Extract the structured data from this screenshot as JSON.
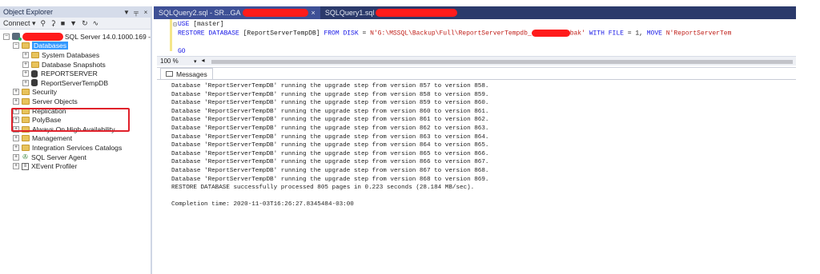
{
  "object_explorer": {
    "title": "Object Explorer",
    "title_buttons": [
      "▼",
      "╤",
      "×"
    ],
    "toolbar": {
      "connect_label": "Connect ▾",
      "icons": [
        "connect-icon",
        "disconnect-icon",
        "stop-icon",
        "filter-icon",
        "refresh-icon",
        "activity-icon"
      ]
    },
    "server_label": "SQL Server 14.0.1000.169 -",
    "tree": [
      {
        "label": "Databases",
        "level": 1,
        "icon": "folder",
        "expanded": true,
        "selected": true
      },
      {
        "label": "System Databases",
        "level": 2,
        "icon": "folder"
      },
      {
        "label": "Database Snapshots",
        "level": 2,
        "icon": "folder"
      },
      {
        "label": "REPORTSERVER",
        "level": 2,
        "icon": "database"
      },
      {
        "label": "ReportServerTempDB",
        "level": 2,
        "icon": "database"
      },
      {
        "label": "Security",
        "level": 1,
        "icon": "folder"
      },
      {
        "label": "Server Objects",
        "level": 1,
        "icon": "folder"
      },
      {
        "label": "Replication",
        "level": 1,
        "icon": "folder"
      },
      {
        "label": "PolyBase",
        "level": 1,
        "icon": "folder"
      },
      {
        "label": "Always On High Availability",
        "level": 1,
        "icon": "folder"
      },
      {
        "label": "Management",
        "level": 1,
        "icon": "folder"
      },
      {
        "label": "Integration Services Catalogs",
        "level": 1,
        "icon": "folder"
      },
      {
        "label": "SQL Server Agent",
        "level": 1,
        "icon": "agent"
      },
      {
        "label": "XEvent Profiler",
        "level": 1,
        "icon": "profiler"
      }
    ]
  },
  "tabs": [
    {
      "label": "SQLQuery2.sql - SR...GA",
      "active": true,
      "close": "×"
    },
    {
      "label": "SQLQuery1.sql",
      "active": false
    }
  ],
  "editor": {
    "line1": {
      "kw": "USE",
      "rest": " [master]"
    },
    "line2": {
      "kw1": "RESTORE DATABASE",
      "mid1": " [ReportServerTempDB] ",
      "kw2": "FROM",
      "mid2": "  ",
      "kw3": "DISK",
      "mid3": " = ",
      "str1": "N'G:\\MSSQL\\Backup\\Full\\ReportServerTempdb_",
      "str2": "bak'",
      "kw4": " WITH",
      "mid4": "  ",
      "kw5": "FILE",
      "mid5": " = 1,  ",
      "kw6": "MOVE",
      "str3": " N'ReportServerTem"
    },
    "line3": "GO",
    "zoom": "100 %"
  },
  "messages": {
    "tab_label": "Messages",
    "lines": [
      "Database 'ReportServerTempDB' running the upgrade step from version 857 to version 858.",
      "Database 'ReportServerTempDB' running the upgrade step from version 858 to version 859.",
      "Database 'ReportServerTempDB' running the upgrade step from version 859 to version 860.",
      "Database 'ReportServerTempDB' running the upgrade step from version 860 to version 861.",
      "Database 'ReportServerTempDB' running the upgrade step from version 861 to version 862.",
      "Database 'ReportServerTempDB' running the upgrade step from version 862 to version 863.",
      "Database 'ReportServerTempDB' running the upgrade step from version 863 to version 864.",
      "Database 'ReportServerTempDB' running the upgrade step from version 864 to version 865.",
      "Database 'ReportServerTempDB' running the upgrade step from version 865 to version 866.",
      "Database 'ReportServerTempDB' running the upgrade step from version 866 to version 867.",
      "Database 'ReportServerTempDB' running the upgrade step from version 867 to version 868.",
      "Database 'ReportServerTempDB' running the upgrade step from version 868 to version 869.",
      "RESTORE DATABASE successfully processed 805 pages in 0.223 seconds (28.184 MB/sec)."
    ],
    "completion": "Completion time: 2020-11-03T16:26:27.8345484-03:00"
  },
  "colors": {
    "tab_bar": "#2b3a6b",
    "selection": "#3399ff",
    "highlight_box": "#e0202a",
    "redaction": "#ff1b1b",
    "keyword": "#1515e6",
    "string": "#c0201a"
  }
}
